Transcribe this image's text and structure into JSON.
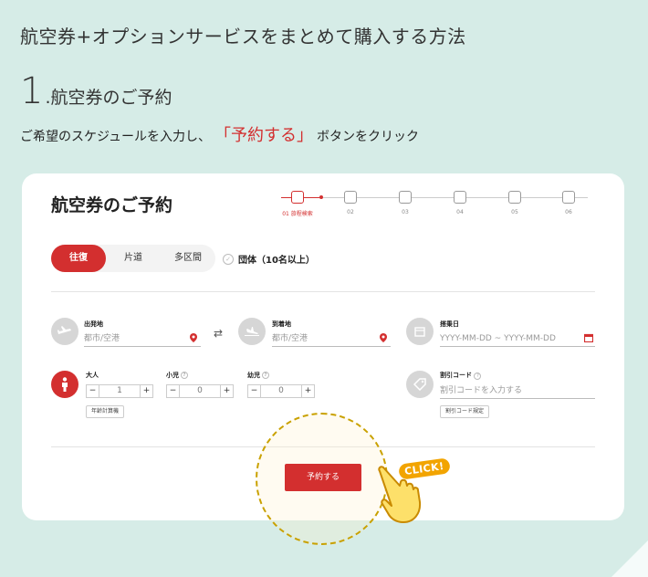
{
  "page_title": "航空券+オプションサービスをまとめて購入する方法",
  "step": {
    "number": "1",
    "text": ".航空券のご予約"
  },
  "instruction": {
    "before": "ご希望のスケジュールを入力し、",
    "highlight": "「予約する」",
    "after": "ボタンをクリック"
  },
  "card": {
    "title": "航空券のご予約",
    "progress": [
      {
        "label": "01 旅程検索",
        "icon": "calendar-icon",
        "active": true
      },
      {
        "label": "02",
        "icon": "edit-icon",
        "active": false
      },
      {
        "label": "03",
        "icon": "gift-icon",
        "active": false
      },
      {
        "label": "04",
        "icon": "document-icon",
        "active": false
      },
      {
        "label": "05",
        "icon": "shield-icon",
        "active": false
      },
      {
        "label": "06",
        "icon": "ticket-icon",
        "active": false
      }
    ],
    "trip_tabs": [
      "往復",
      "片道",
      "多区間"
    ],
    "selected_trip": "往復",
    "group_label": "団体（10名以上）",
    "departure": {
      "label": "出発地",
      "placeholder": "都市/空港",
      "icon": "plane-takeoff-icon"
    },
    "arrival": {
      "label": "到着地",
      "placeholder": "都市/空港",
      "icon": "plane-landing-icon"
    },
    "dates": {
      "label": "搭乗日",
      "placeholder": "YYYY-MM-DD  ~ YYYY-MM-DD",
      "icon": "calendar-icon"
    },
    "passengers": {
      "adult": {
        "label": "大人",
        "value": "1"
      },
      "child": {
        "label": "小児",
        "value": "0"
      },
      "infant": {
        "label": "幼児",
        "value": "0"
      },
      "age_calc": "年齢計算機"
    },
    "discount": {
      "label": "割引コード",
      "placeholder": "割引コードを入力する",
      "rules": "割引コード規定",
      "icon": "tag-icon"
    },
    "submit": "予約する",
    "click_badge": "CLICK!"
  },
  "colors": {
    "accent": "#d32f2f",
    "background": "#d6ece7",
    "badge": "#f2a400"
  }
}
